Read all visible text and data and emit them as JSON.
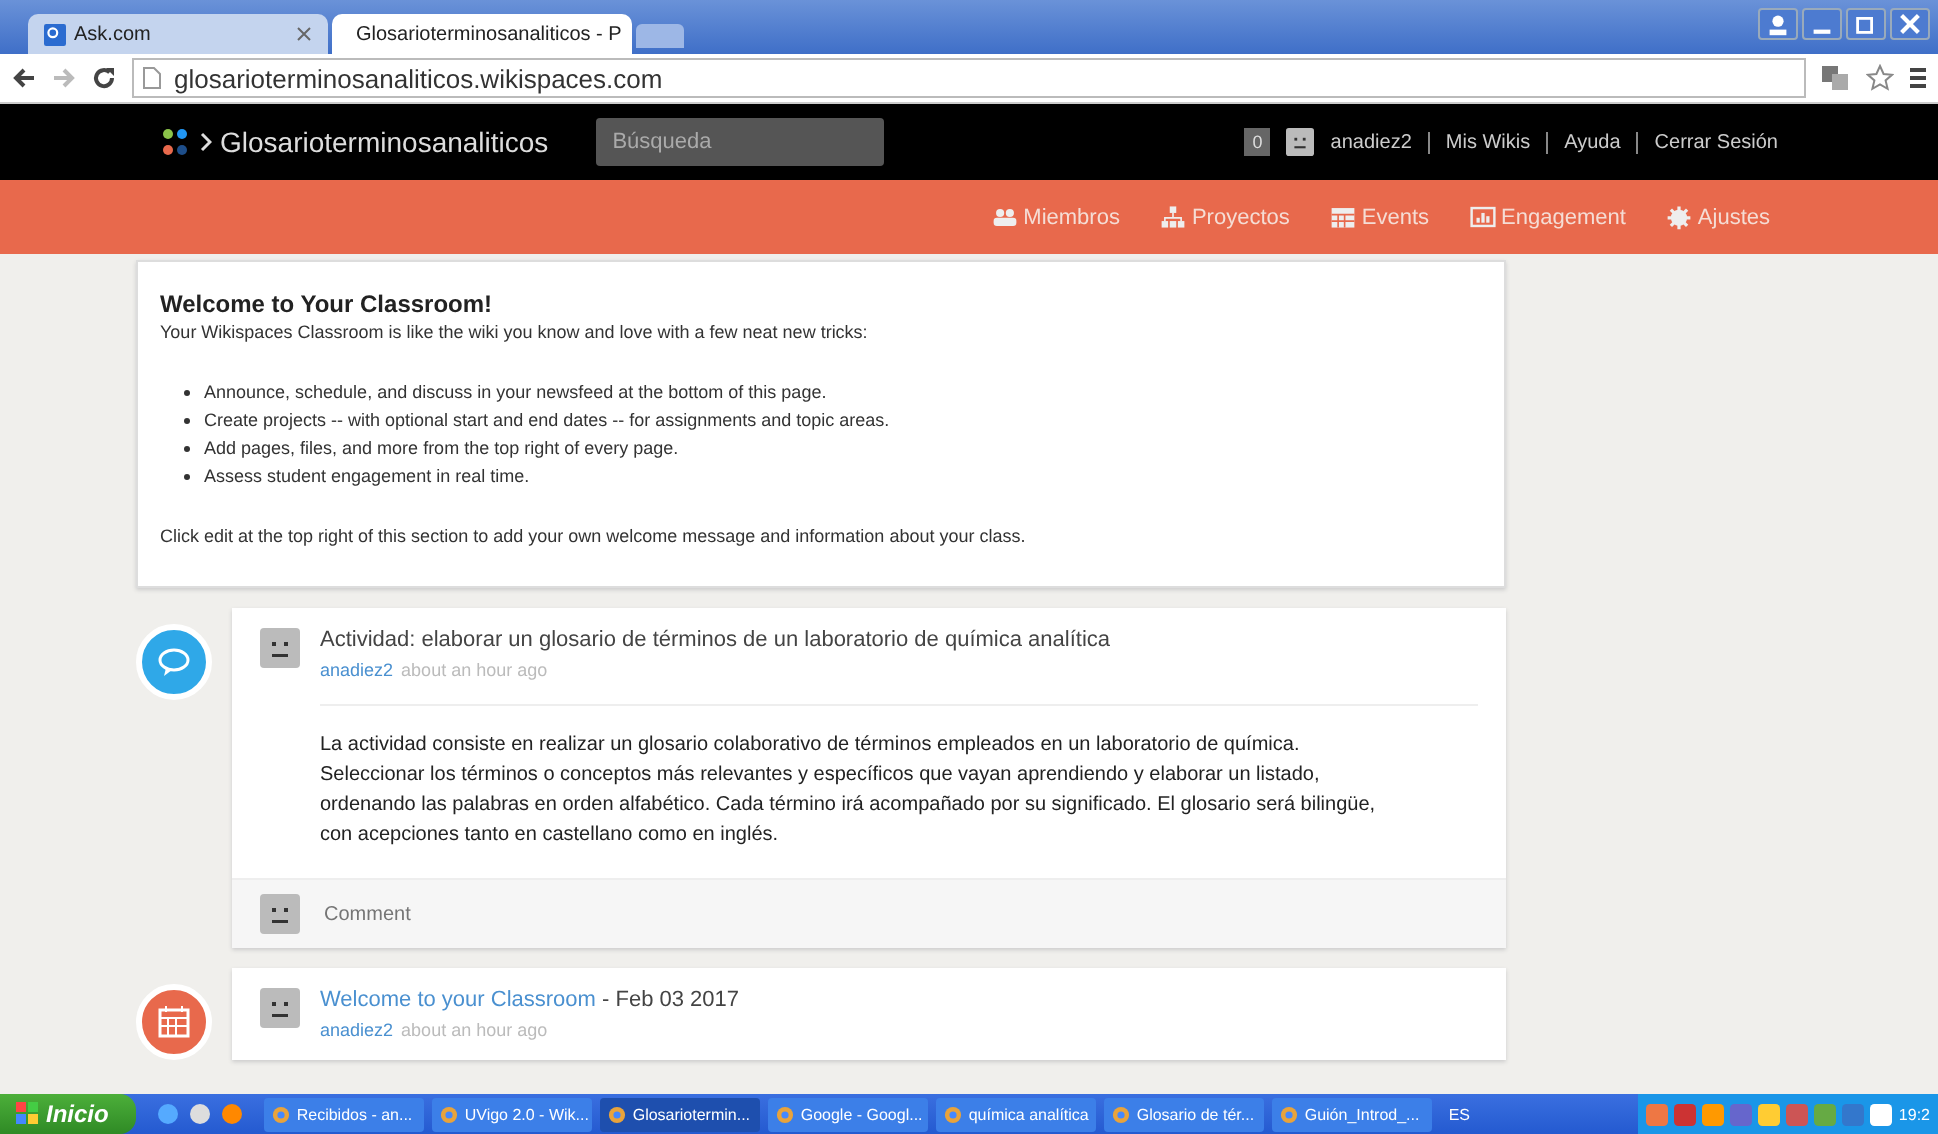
{
  "browser": {
    "tabs": [
      {
        "label": "Ask.com",
        "selected": false
      },
      {
        "label": "Glosarioterminosanaliticos - P",
        "selected": true
      }
    ],
    "address": "glosarioterminosanaliticos.wikispaces.com"
  },
  "header": {
    "site_name": "Glosarioterminosanaliticos",
    "search": {
      "placeholder": "Búsqueda"
    },
    "notifications": "0",
    "user_links": [
      "anadiez2",
      "Mis Wikis",
      "Ayuda",
      "Cerrar Sesión"
    ]
  },
  "nav": [
    {
      "label": "Miembros"
    },
    {
      "label": "Proyectos"
    },
    {
      "label": "Events"
    },
    {
      "label": "Engagement"
    },
    {
      "label": "Ajustes"
    }
  ],
  "welcome": {
    "title": "Welcome to Your Classroom!",
    "intro": "Your Wikispaces Classroom is like the wiki you know and love with a few neat new tricks:",
    "bullets": [
      "Announce, schedule, and discuss in your newsfeed at the bottom of this page.",
      "Create projects -- with optional start and end dates -- for assignments and topic areas.",
      "Add pages, files, and more from the top right of every page.",
      "Assess student engagement in real time."
    ],
    "footer": "Click edit at the top right of this section to add your own welcome message and information about your class."
  },
  "feed": [
    {
      "kind": "discussion",
      "title": "Actividad: elaborar un glosario de términos de un laboratorio de química analítica",
      "author": "anadiez2",
      "time": "about an hour ago",
      "body": "La actividad consiste en realizar un glosario colaborativo de términos empleados en un laboratorio de química. Seleccionar los términos o conceptos más relevantes y específicos que vayan aprendiendo y elaborar un listado, ordenando las palabras en orden alfabético. Cada término irá acompañado por su significado. El glosario será bilingüe, con acepciones tanto en castellano como en inglés.",
      "comment_placeholder": "Comment"
    },
    {
      "kind": "event",
      "title": "Welcome to your Classroom",
      "date": "- Feb 03 2017",
      "author": "anadiez2",
      "time": "about an hour ago"
    }
  ],
  "taskbar": {
    "start": "Inicio",
    "items": [
      {
        "label": "Recibidos - an...",
        "selected": false
      },
      {
        "label": "UVigo 2.0 - Wik...",
        "selected": false
      },
      {
        "label": "Glosariotermin...",
        "selected": true
      },
      {
        "label": "Google - Googl...",
        "selected": false
      },
      {
        "label": "química analítica",
        "selected": false
      },
      {
        "label": "Glosario de tér...",
        "selected": false
      },
      {
        "label": "Guión_Introd_...",
        "selected": false
      }
    ],
    "language": "ES",
    "clock": "19:2"
  }
}
